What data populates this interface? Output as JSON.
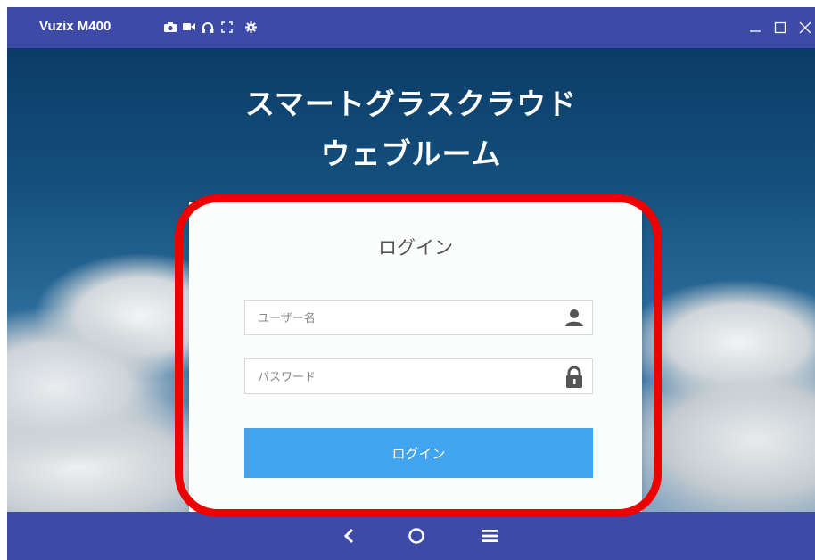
{
  "window": {
    "title": "Vuzix M400",
    "toolbar_icons": [
      "camera-icon",
      "video-icon",
      "headset-icon",
      "fullscreen-icon",
      "gear-icon"
    ],
    "controls": [
      "minimize-icon",
      "maximize-icon",
      "close-icon"
    ]
  },
  "screen": {
    "headline_line1": "スマートグラスクラウド",
    "headline_line2": "ウェブルーム"
  },
  "login": {
    "title": "ログイン",
    "username_placeholder": "ユーザー名",
    "password_placeholder": "パスワード",
    "submit_label": "ログイン",
    "username_icon": "user-icon",
    "password_icon": "lock-icon"
  },
  "nav": {
    "items": [
      "back-icon",
      "home-icon",
      "menu-icon"
    ]
  },
  "colors": {
    "titlebar": "#3d4aa8",
    "button": "#42a5f2",
    "highlight": "#ef0000"
  }
}
